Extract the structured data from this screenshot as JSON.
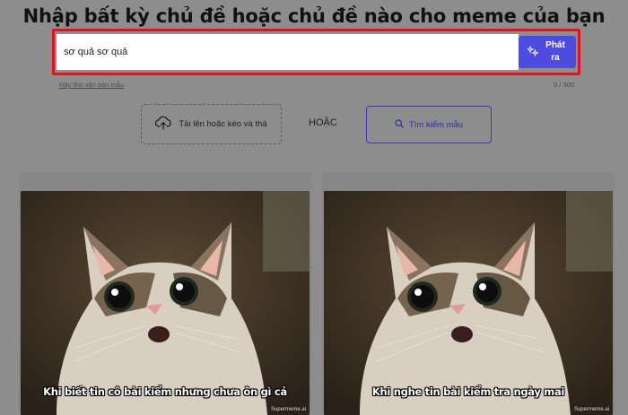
{
  "header": {
    "title": "Nhập bất kỳ chủ đề hoặc chủ đề nào cho meme của bạn"
  },
  "prompt": {
    "value": "sơ quả sơ quả",
    "generate_label": "Phát ra",
    "sample_link": "Hãy thử văn bản mẫu",
    "char_count": "0 / 300"
  },
  "actions": {
    "upload_label": "Tải lên hoặc kéo và thả",
    "or_label": "HOẶC",
    "search_label": "Tìm kiếm mẫu"
  },
  "results": [
    {
      "caption": "Khi biết tin cô bài kiểm nhưng chưa ôn gì cả",
      "watermark": "Supermeme.ai"
    },
    {
      "caption": "Khi nghe tin bài kiểm tra ngày mai",
      "watermark": "Supermeme.ai"
    }
  ],
  "colors": {
    "accent": "#4e4cde",
    "highlight": "#e0141e",
    "overlay": "#8d8d8d"
  }
}
